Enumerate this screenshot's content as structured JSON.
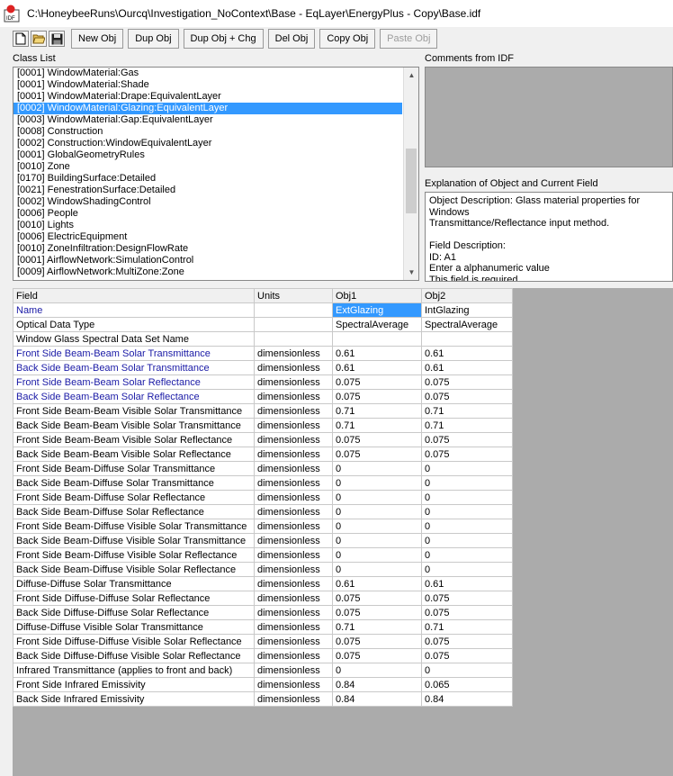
{
  "window": {
    "title": "C:\\HoneybeeRuns\\Ourcq\\Investigation_NoContext\\Base - EqLayer\\EnergyPlus - Copy\\Base.idf"
  },
  "toolbar": {
    "new_obj": "New Obj",
    "dup_obj": "Dup Obj",
    "dup_obj_chg": "Dup Obj + Chg",
    "del_obj": "Del Obj",
    "copy_obj": "Copy Obj",
    "paste_obj": "Paste Obj"
  },
  "class_list": {
    "label": "Class List",
    "items": [
      "[0001]  WindowMaterial:Gas",
      "[0001]  WindowMaterial:Shade",
      "[0001]  WindowMaterial:Drape:EquivalentLayer",
      "[0002]  WindowMaterial:Glazing:EquivalentLayer",
      "[0003]  WindowMaterial:Gap:EquivalentLayer",
      "[0008]  Construction",
      "[0002]  Construction:WindowEquivalentLayer",
      "[0001]  GlobalGeometryRules",
      "[0010]  Zone",
      "[0170]  BuildingSurface:Detailed",
      "[0021]  FenestrationSurface:Detailed",
      "[0002]  WindowShadingControl",
      "[0006]  People",
      "[0010]  Lights",
      "[0006]  ElectricEquipment",
      "[0010]  ZoneInfiltration:DesignFlowRate",
      "[0001]  AirflowNetwork:SimulationControl",
      "[0009]  AirflowNetwork:MultiZone:Zone"
    ],
    "selected_index": 3
  },
  "comments": {
    "label": "Comments from IDF"
  },
  "explanation": {
    "label": "Explanation of Object and Current Field",
    "text": "Object Description: Glass material properties for Windows\nTransmittance/Reflectance input method.\n\nField Description:\nID: A1\nEnter a alphanumeric value\nThis field is required."
  },
  "grid": {
    "headers": [
      "Field",
      "Units",
      "Obj1",
      "Obj2"
    ],
    "rows": [
      {
        "field": "Name",
        "units": "",
        "obj1": "ExtGlazing",
        "obj2": "IntGlazing",
        "blue": true
      },
      {
        "field": "Optical Data Type",
        "units": "",
        "obj1": "SpectralAverage",
        "obj2": "SpectralAverage",
        "blue": false
      },
      {
        "field": "Window Glass Spectral Data Set Name",
        "units": "",
        "obj1": "",
        "obj2": "",
        "blue": false
      },
      {
        "field": "Front Side Beam-Beam Solar Transmittance",
        "units": "dimensionless",
        "obj1": "0.61",
        "obj2": "0.61",
        "blue": true
      },
      {
        "field": "Back Side Beam-Beam Solar Transmittance",
        "units": "dimensionless",
        "obj1": "0.61",
        "obj2": "0.61",
        "blue": true
      },
      {
        "field": "Front Side Beam-Beam Solar Reflectance",
        "units": "dimensionless",
        "obj1": "0.075",
        "obj2": "0.075",
        "blue": true
      },
      {
        "field": "Back Side Beam-Beam Solar Reflectance",
        "units": "dimensionless",
        "obj1": "0.075",
        "obj2": "0.075",
        "blue": true
      },
      {
        "field": "Front Side Beam-Beam Visible Solar Transmittance",
        "units": "dimensionless",
        "obj1": "0.71",
        "obj2": "0.71",
        "blue": false
      },
      {
        "field": "Back Side Beam-Beam Visible Solar Transmittance",
        "units": "dimensionless",
        "obj1": "0.71",
        "obj2": "0.71",
        "blue": false
      },
      {
        "field": "Front Side Beam-Beam Visible Solar Reflectance",
        "units": "dimensionless",
        "obj1": "0.075",
        "obj2": "0.075",
        "blue": false
      },
      {
        "field": "Back Side Beam-Beam Visible Solar Reflectance",
        "units": "dimensionless",
        "obj1": "0.075",
        "obj2": "0.075",
        "blue": false
      },
      {
        "field": "Front Side Beam-Diffuse Solar Transmittance",
        "units": "dimensionless",
        "obj1": "0",
        "obj2": "0",
        "blue": false
      },
      {
        "field": "Back Side Beam-Diffuse Solar Transmittance",
        "units": "dimensionless",
        "obj1": "0",
        "obj2": "0",
        "blue": false
      },
      {
        "field": "Front Side Beam-Diffuse Solar Reflectance",
        "units": "dimensionless",
        "obj1": "0",
        "obj2": "0",
        "blue": false
      },
      {
        "field": "Back Side Beam-Diffuse Solar Reflectance",
        "units": "dimensionless",
        "obj1": "0",
        "obj2": "0",
        "blue": false
      },
      {
        "field": "Front Side Beam-Diffuse Visible Solar Transmittance",
        "units": "dimensionless",
        "obj1": "0",
        "obj2": "0",
        "blue": false
      },
      {
        "field": "Back Side Beam-Diffuse Visible Solar Transmittance",
        "units": "dimensionless",
        "obj1": "0",
        "obj2": "0",
        "blue": false
      },
      {
        "field": "Front Side Beam-Diffuse Visible Solar Reflectance",
        "units": "dimensionless",
        "obj1": "0",
        "obj2": "0",
        "blue": false
      },
      {
        "field": "Back Side Beam-Diffuse Visible Solar Reflectance",
        "units": "dimensionless",
        "obj1": "0",
        "obj2": "0",
        "blue": false
      },
      {
        "field": "Diffuse-Diffuse Solar Transmittance",
        "units": "dimensionless",
        "obj1": "0.61",
        "obj2": "0.61",
        "blue": false
      },
      {
        "field": "Front Side Diffuse-Diffuse Solar Reflectance",
        "units": "dimensionless",
        "obj1": "0.075",
        "obj2": "0.075",
        "blue": false
      },
      {
        "field": "Back Side Diffuse-Diffuse Solar Reflectance",
        "units": "dimensionless",
        "obj1": "0.075",
        "obj2": "0.075",
        "blue": false
      },
      {
        "field": "Diffuse-Diffuse Visible Solar Transmittance",
        "units": "dimensionless",
        "obj1": "0.71",
        "obj2": "0.71",
        "blue": false
      },
      {
        "field": "Front Side Diffuse-Diffuse Visible Solar Reflectance",
        "units": "dimensionless",
        "obj1": "0.075",
        "obj2": "0.075",
        "blue": false
      },
      {
        "field": "Back Side Diffuse-Diffuse Visible Solar Reflectance",
        "units": "dimensionless",
        "obj1": "0.075",
        "obj2": "0.075",
        "blue": false
      },
      {
        "field": "Infrared Transmittance (applies to front and back)",
        "units": "dimensionless",
        "obj1": "0",
        "obj2": "0",
        "blue": false
      },
      {
        "field": "Front Side Infrared Emissivity",
        "units": "dimensionless",
        "obj1": "0.84",
        "obj2": "0.065",
        "blue": false
      },
      {
        "field": "Back Side Infrared Emissivity",
        "units": "dimensionless",
        "obj1": "0.84",
        "obj2": "0.84",
        "blue": false
      }
    ]
  }
}
